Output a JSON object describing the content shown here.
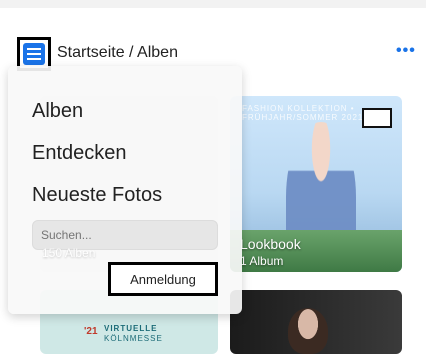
{
  "header": {
    "breadcrumb": "Startseite / Alben",
    "more_label": "•••"
  },
  "menu": {
    "items": [
      "Alben",
      "Entdecken",
      "Neueste Fotos"
    ],
    "search_placeholder": "Suchen...",
    "login_label": "Anmeldung"
  },
  "albums": [
    {
      "title": "",
      "count_text": "150 Alben"
    },
    {
      "headline": "FASHION KOLLEKTION • FRÜHJAHR/SOMMER 2021",
      "title": "Lookbook",
      "count_text": "1 Album"
    },
    {
      "title": "VIRTUELLE KÖLNMESSE"
    },
    {
      "title": ""
    }
  ],
  "colors": {
    "accent": "#1a73e8",
    "overlay": "#f8f8f8",
    "text": "#222222"
  },
  "icons": {
    "menu": "hamburger-icon",
    "more": "ellipsis-icon"
  }
}
